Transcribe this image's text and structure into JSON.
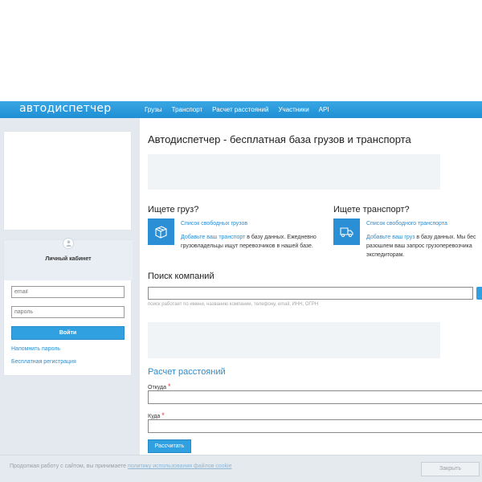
{
  "header": {
    "logo": "автодиспетчер",
    "nav": [
      "Грузы",
      "Транспорт",
      "Расчет расстояний",
      "Участники",
      "API"
    ]
  },
  "sidebar": {
    "login": {
      "title": "Личный кабинет",
      "email_placeholder": "email",
      "password_placeholder": "пароль",
      "submit_label": "Войти",
      "remind_link": "Напомнить пароль",
      "register_link": "Бесплатная регистрация"
    }
  },
  "main": {
    "title": "Автодиспетчер - бесплатная база грузов и транспорта",
    "cargo": {
      "title": "Ищете груз?",
      "list_link": "Список свободных грузов",
      "add_link": "Добавьте ваш транспорт",
      "add_text": " в базу данных. Ежедневно грузовладельцы ищут перевозчиков в нашей базе."
    },
    "transport": {
      "title": "Ищете транспорт?",
      "list_link": "Список свободного транспорта",
      "add_link": "Добавьте ваш груз",
      "add_text": " в базу данных. Мы бес разошлем ваш запрос грузоперевозчика экспедиторам."
    },
    "search": {
      "title": "Поиск компаний",
      "hint": "поиск работает по имени, названию компании, телефону, email, ИНН, ОГРН"
    },
    "distance": {
      "title": "Расчет расстояний",
      "from_label": "Откуда",
      "to_label": "Куда",
      "required_mark": "*",
      "submit_label": "Рассчитать"
    }
  },
  "cookie": {
    "text": "Продолжая работу с сайтом, вы принимаете ",
    "link": "политику использования файлов cookie",
    "button": "Закрыть"
  },
  "colors": {
    "accent": "#2a8fd4",
    "link": "#2a8dd0",
    "required": "#e23a3a"
  }
}
